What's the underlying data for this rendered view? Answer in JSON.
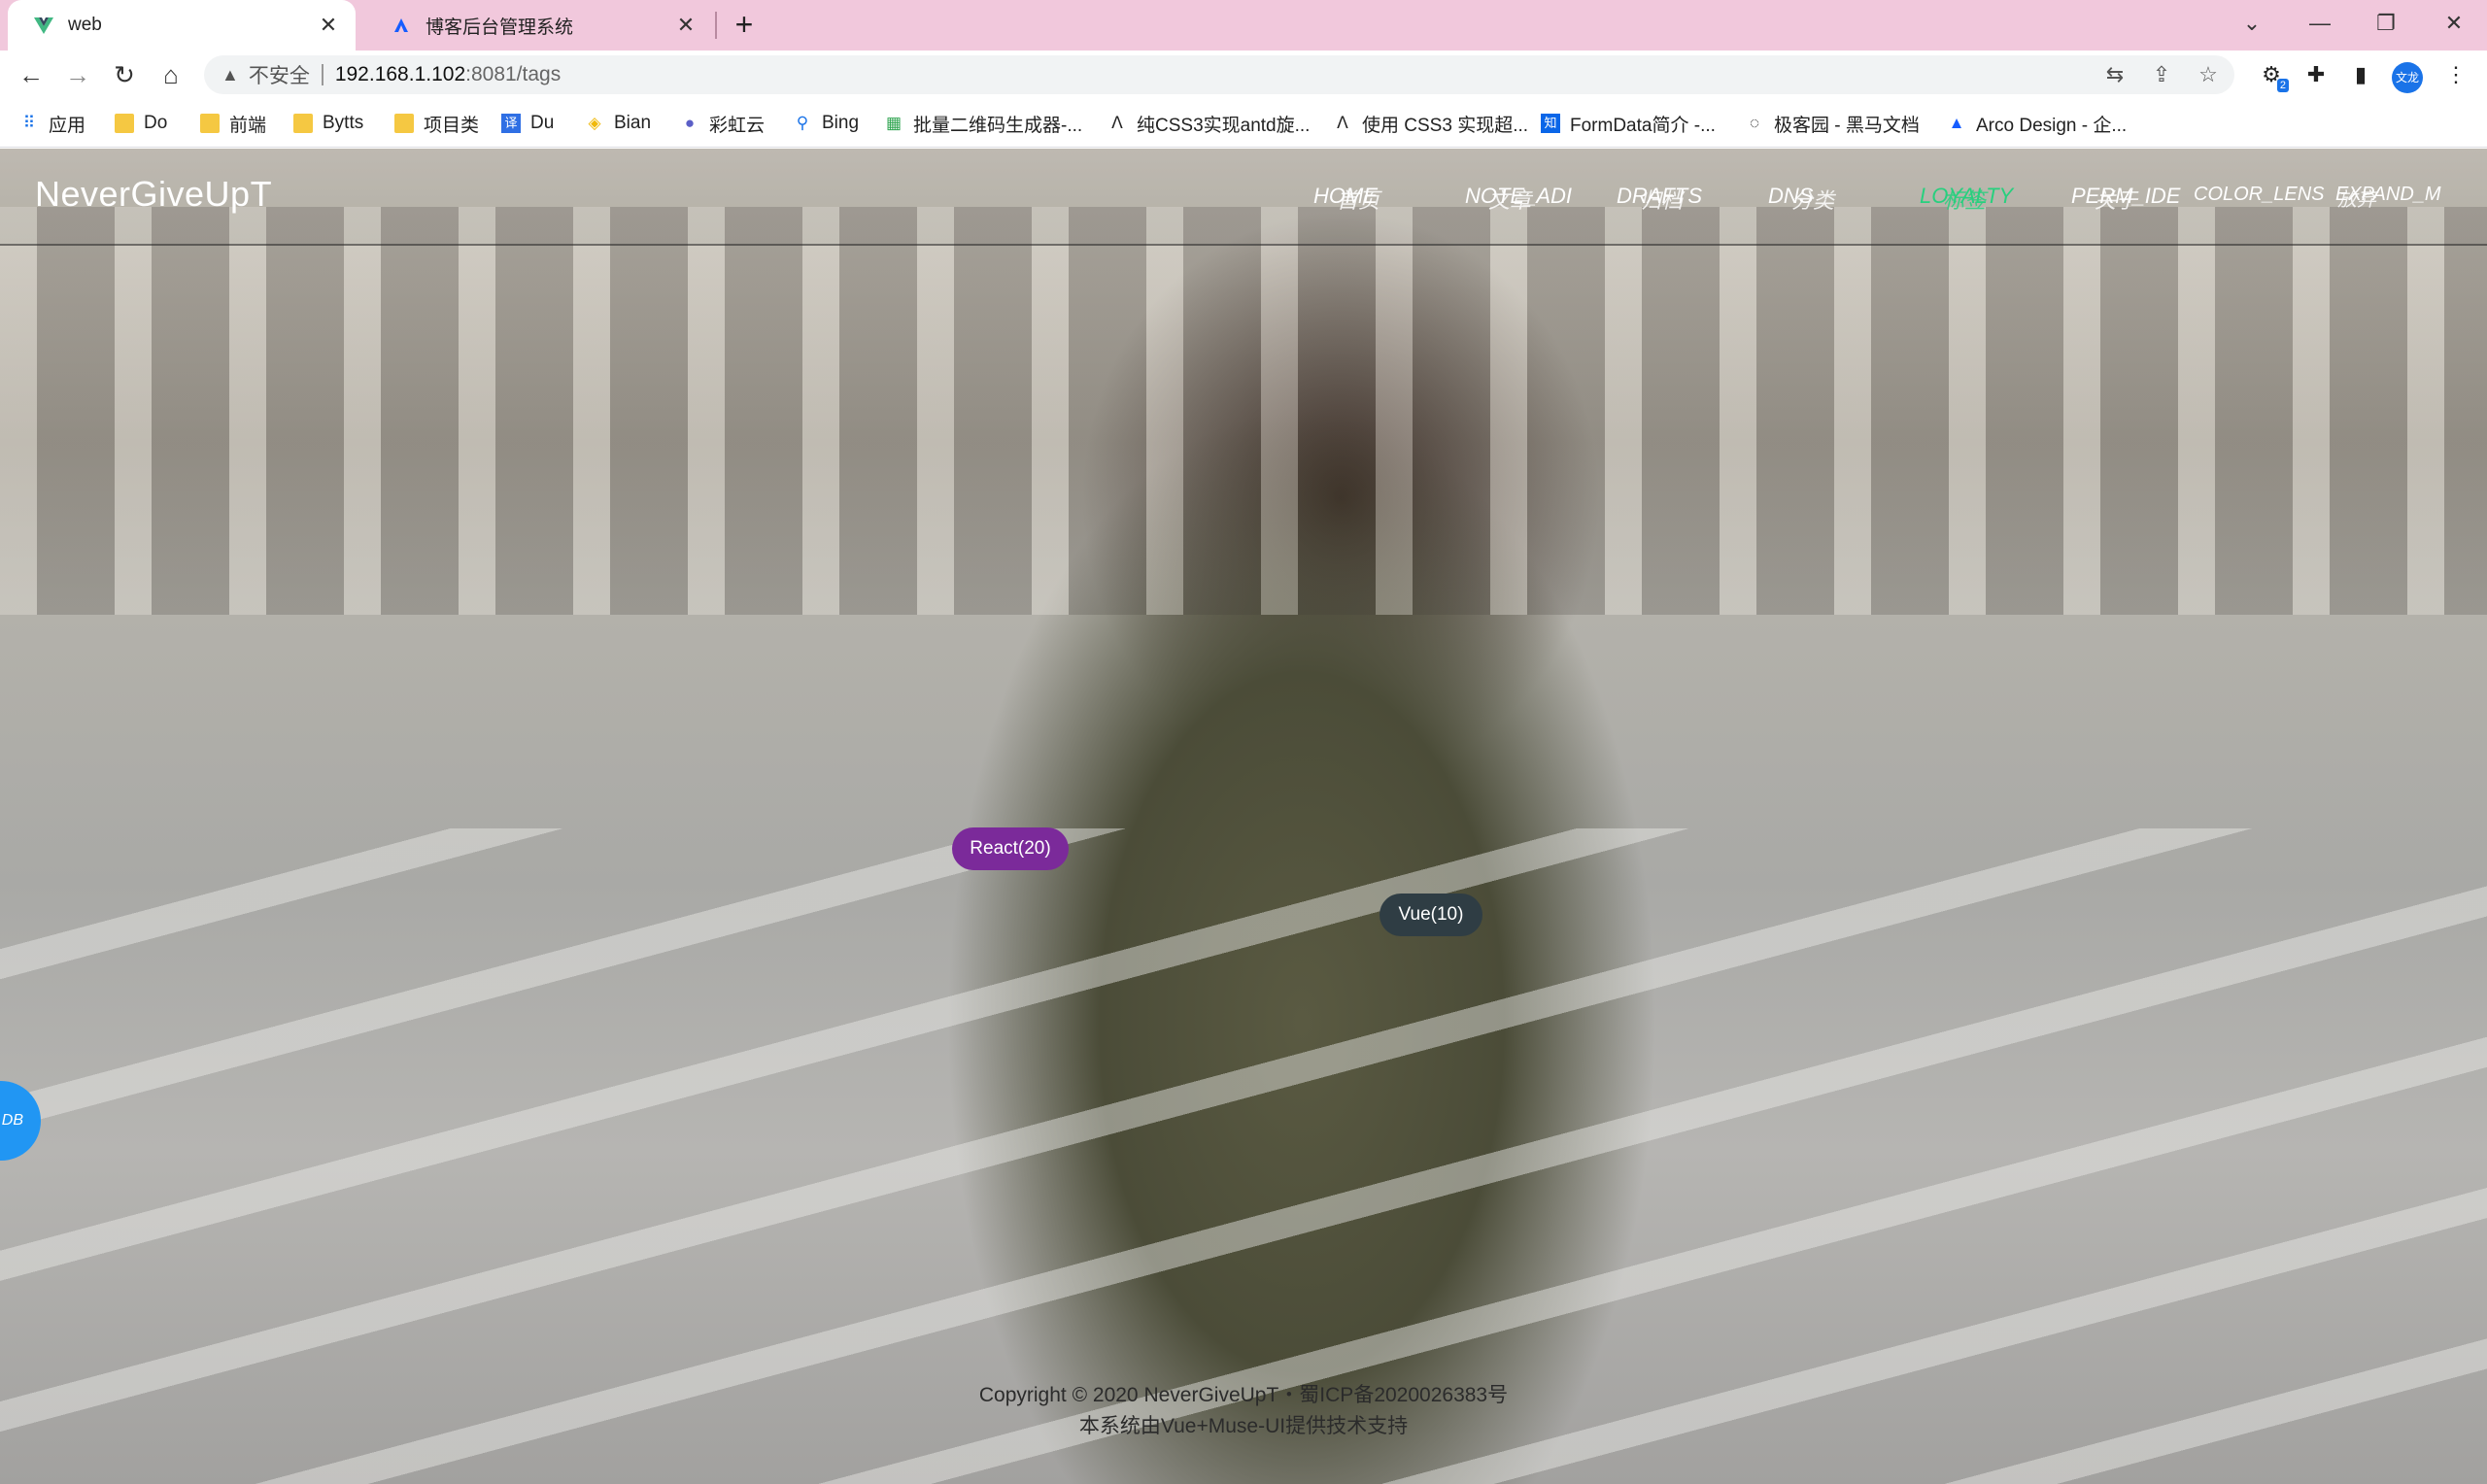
{
  "browser": {
    "tabs": [
      {
        "title": "web",
        "icon": "vue-logo-icon"
      },
      {
        "title": "博客后台管理系统",
        "icon": "arco-logo-icon"
      }
    ],
    "address": {
      "security_label": "不安全",
      "host": "192.168.1.102",
      "path": ":8081/tags"
    },
    "extension_badge": "2",
    "profile_label": "文龙",
    "bookmarks": [
      {
        "label": "应用",
        "icon": "apps-grid-icon"
      },
      {
        "label": "Do",
        "icon": "folder-icon"
      },
      {
        "label": "前端",
        "icon": "folder-icon"
      },
      {
        "label": "Bytts",
        "icon": "folder-icon"
      },
      {
        "label": "项目类",
        "icon": "folder-icon"
      },
      {
        "label": "Du",
        "icon": "translate-icon"
      },
      {
        "label": "Bian",
        "icon": "binance-icon"
      },
      {
        "label": "彩虹云",
        "icon": "cloud-icon"
      },
      {
        "label": "Bing",
        "icon": "search-icon"
      },
      {
        "label": "批量二维码生成器-...",
        "icon": "qrcode-icon"
      },
      {
        "label": "纯CSS3实现antd旋...",
        "icon": "juejin-icon"
      },
      {
        "label": "使用 CSS3 实现超...",
        "icon": "juejin-icon"
      },
      {
        "label": "FormData简介 -...",
        "icon": "zhihu-icon"
      },
      {
        "label": "极客园 - 黑马文档",
        "icon": "geek-icon"
      },
      {
        "label": "Arco Design - 企...",
        "icon": "arco-logo-icon"
      }
    ]
  },
  "site": {
    "brand": "NeverGiveUpT",
    "nav": [
      {
        "label": "HOME",
        "overlay": "首页",
        "active": false
      },
      {
        "label": "NOTE_ADI",
        "overlay": "文章",
        "active": false
      },
      {
        "label": "DRAFTS",
        "overlay": "归档",
        "active": false
      },
      {
        "label": "DNS",
        "overlay": "分类",
        "active": false
      },
      {
        "label": "LOYALTY",
        "overlay": "标签",
        "active": true
      },
      {
        "label": "PERM_IDE",
        "overlay": "关于",
        "active": false
      },
      {
        "label": "COLOR_LENS",
        "overlay": "",
        "active": false
      },
      {
        "label": "EXPAND_M",
        "overlay": "放弃",
        "active": false
      }
    ],
    "tags": [
      {
        "label": "React(20)",
        "color": "#7b2a9a"
      },
      {
        "label": "Vue(10)",
        "color": "#2f3d44"
      }
    ],
    "fab_label": "DB",
    "footer": {
      "copyright": "Copyright © 2020 NeverGiveUpT・蜀ICP备2020026383号",
      "powered": "本系统由Vue+Muse-UI提供技术支持"
    }
  }
}
